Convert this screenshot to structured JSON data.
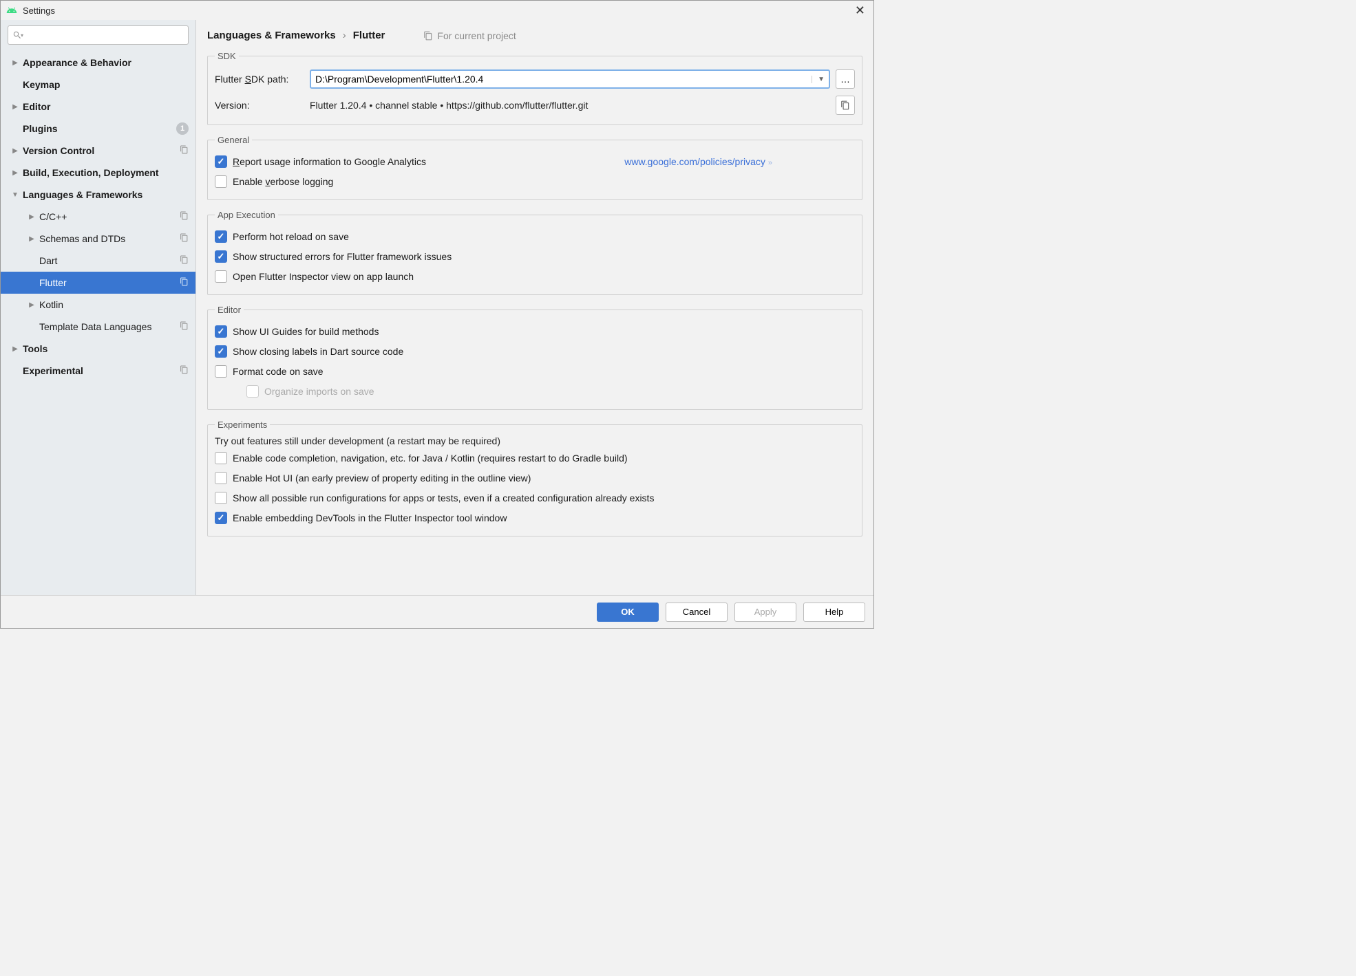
{
  "window": {
    "title": "Settings"
  },
  "sidebar": {
    "search_placeholder": "",
    "items": [
      {
        "label": "Appearance & Behavior",
        "bold": true,
        "arrow": "right",
        "level": 0
      },
      {
        "label": "Keymap",
        "bold": true,
        "arrow": "none",
        "level": 0
      },
      {
        "label": "Editor",
        "bold": true,
        "arrow": "right",
        "level": 0
      },
      {
        "label": "Plugins",
        "bold": true,
        "arrow": "none",
        "level": 0,
        "badge": "1"
      },
      {
        "label": "Version Control",
        "bold": true,
        "arrow": "right",
        "level": 0,
        "copy": true
      },
      {
        "label": "Build, Execution, Deployment",
        "bold": true,
        "arrow": "right",
        "level": 0
      },
      {
        "label": "Languages & Frameworks",
        "bold": true,
        "arrow": "down",
        "level": 0
      },
      {
        "label": "C/C++",
        "bold": false,
        "arrow": "right",
        "level": 1,
        "copy": true
      },
      {
        "label": "Schemas and DTDs",
        "bold": false,
        "arrow": "right",
        "level": 1,
        "copy": true
      },
      {
        "label": "Dart",
        "bold": false,
        "arrow": "none",
        "level": 1,
        "copy": true
      },
      {
        "label": "Flutter",
        "bold": false,
        "arrow": "none",
        "level": 1,
        "copy": true,
        "selected": true
      },
      {
        "label": "Kotlin",
        "bold": false,
        "arrow": "right",
        "level": 1
      },
      {
        "label": "Template Data Languages",
        "bold": false,
        "arrow": "none",
        "level": 1,
        "copy": true
      },
      {
        "label": "Tools",
        "bold": true,
        "arrow": "right",
        "level": 0
      },
      {
        "label": "Experimental",
        "bold": true,
        "arrow": "none",
        "level": 0,
        "copy": true
      }
    ]
  },
  "breadcrumb": {
    "parent": "Languages & Frameworks",
    "current": "Flutter",
    "scope": "For current project"
  },
  "sdk": {
    "legend": "SDK",
    "path_label": "Flutter SDK path:",
    "path_value": "D:\\Program\\Development\\Flutter\\1.20.4",
    "version_label": "Version:",
    "version_value": "Flutter 1.20.4 • channel stable • https://github.com/flutter/flutter.git"
  },
  "general": {
    "legend": "General",
    "report_usage": "Report usage information to Google Analytics",
    "privacy_link": "www.google.com/policies/privacy",
    "verbose_logging": "Enable verbose logging"
  },
  "app_exec": {
    "legend": "App Execution",
    "hot_reload": "Perform hot reload on save",
    "structured_errors": "Show structured errors for Flutter framework issues",
    "open_inspector": "Open Flutter Inspector view on app launch"
  },
  "editor": {
    "legend": "Editor",
    "ui_guides": "Show UI Guides for build methods",
    "closing_labels": "Show closing labels in Dart source code",
    "format_on_save": "Format code on save",
    "organize_imports": "Organize imports on save"
  },
  "experiments": {
    "legend": "Experiments",
    "desc": "Try out features still under development (a restart may be required)",
    "code_completion": "Enable code completion, navigation, etc. for Java / Kotlin (requires restart to do Gradle build)",
    "hot_ui": "Enable Hot UI (an early preview of property editing in the outline view)",
    "all_run_configs": "Show all possible run configurations for apps or tests, even if a created configuration already exists",
    "embed_devtools": "Enable embedding DevTools in the Flutter Inspector tool window"
  },
  "footer": {
    "ok": "OK",
    "cancel": "Cancel",
    "apply": "Apply",
    "help": "Help"
  }
}
